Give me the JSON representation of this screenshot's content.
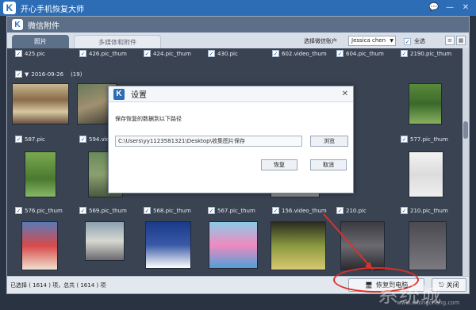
{
  "app": {
    "title": "开心手机恢复大师",
    "logo_letter": "K"
  },
  "panel": {
    "title": "微信附件",
    "logo_letter": "K"
  },
  "tabs": [
    {
      "label": "照片"
    },
    {
      "label": "多媒体和附件"
    }
  ],
  "toolbar": {
    "account_label": "选择微信账户",
    "account_value": "Jessica chen",
    "select_all": "全选"
  },
  "rows": {
    "row1": [
      "425.pic",
      "426.pic_thum",
      "424.pic_thum",
      "430.pic",
      "602.video_thum",
      "604.pic_thum",
      "2190.pic_thum"
    ],
    "date_group": {
      "date": "2016-09-26",
      "count": "(19)"
    },
    "row2": [
      "587.pic",
      "594.video_thum",
      "",
      "",
      "",
      "",
      "577.pic_thum"
    ],
    "row3": [
      "576.pic_thum",
      "569.pic_thum",
      "568.pic_thum",
      "567.pic_thum",
      "156.video_thum",
      "210.pic",
      "210.pic_thum"
    ]
  },
  "status": {
    "text": "已选择 ( 1614 ) 项，总共 ( 1614 ) 项",
    "recover_button": "恢复到电脑",
    "close_button": "关闭"
  },
  "dialog": {
    "logo_letter": "K",
    "title": "设置",
    "prompt": "保存恢复的数据到以下路径",
    "path": "C:\\Users\\yy1123581321\\Desktop\\收集图片保存",
    "browse_button": "浏览",
    "recover_button": "恢复",
    "cancel_button": "取消",
    "close_icon": "close-icon"
  },
  "watermark": {
    "text": "系统城",
    "url": "www.xitongcheng.com"
  },
  "colors": {
    "title_bar": "#2d6db5",
    "panel_header": "#5c6f88",
    "grid_bg": "#3a4352",
    "highlight_red": "#d9322b"
  }
}
